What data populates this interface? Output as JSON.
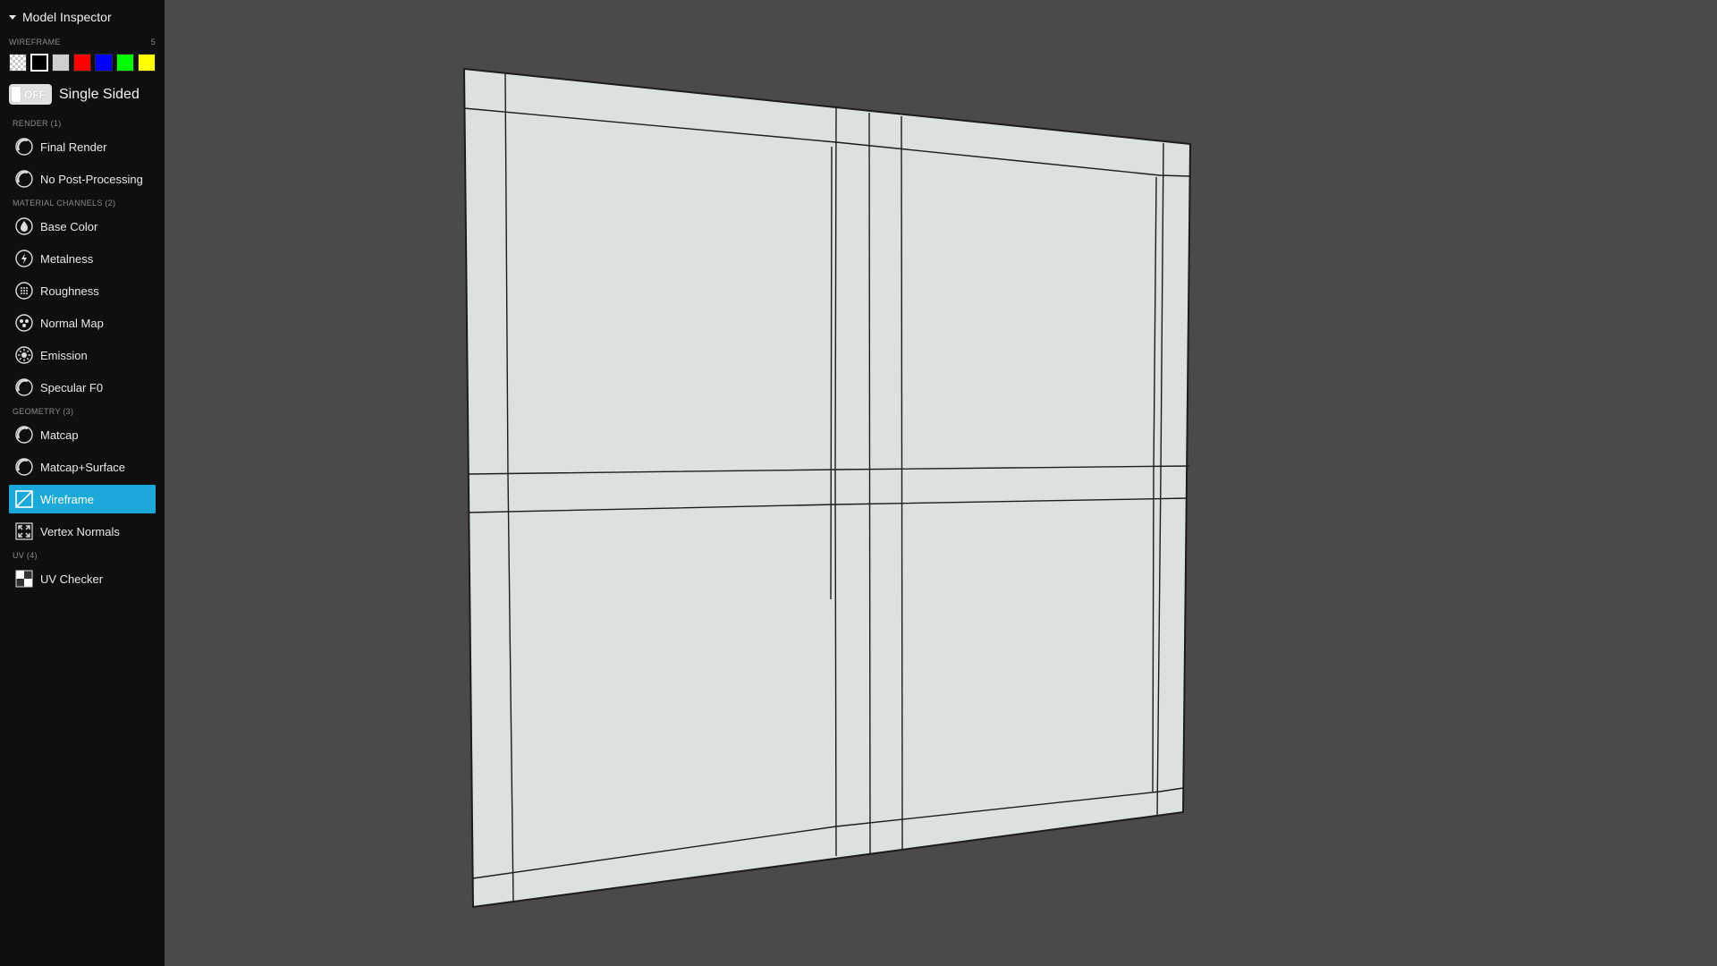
{
  "panel": {
    "title": "Model Inspector",
    "wireframe_label": "WIREFRAME",
    "wireframe_count": "5",
    "swatches": [
      {
        "name": "checker",
        "color": "#ffffff"
      },
      {
        "name": "black",
        "color": "#000000"
      },
      {
        "name": "light-gray",
        "color": "#cfcfcf"
      },
      {
        "name": "red",
        "color": "#ff0000"
      },
      {
        "name": "blue",
        "color": "#0000ff"
      },
      {
        "name": "green",
        "color": "#00ff00"
      },
      {
        "name": "yellow",
        "color": "#ffff00"
      }
    ],
    "toggle": {
      "state": "OFF",
      "label": "Single Sided"
    },
    "sections": [
      {
        "title": "RENDER (1)",
        "items": [
          {
            "label": "Final Render",
            "icon": "sphere-icon"
          },
          {
            "label": "No Post-Processing",
            "icon": "sphere-icon"
          }
        ]
      },
      {
        "title": "MATERIAL CHANNELS (2)",
        "items": [
          {
            "label": "Base Color",
            "icon": "droplet-icon"
          },
          {
            "label": "Metalness",
            "icon": "lightning-icon"
          },
          {
            "label": "Roughness",
            "icon": "dotted-sphere-icon"
          },
          {
            "label": "Normal Map",
            "icon": "normal-sphere-icon"
          },
          {
            "label": "Emission",
            "icon": "sun-icon"
          },
          {
            "label": "Specular F0",
            "icon": "sphere-icon"
          }
        ]
      },
      {
        "title": "GEOMETRY (3)",
        "items": [
          {
            "label": "Matcap",
            "icon": "sphere-icon"
          },
          {
            "label": "Matcap+Surface",
            "icon": "sphere-icon"
          },
          {
            "label": "Wireframe",
            "icon": "wireframe-icon",
            "active": true
          },
          {
            "label": "Vertex Normals",
            "icon": "arrows-icon"
          }
        ]
      },
      {
        "title": "UV (4)",
        "items": [
          {
            "label": "UV Checker",
            "icon": "checker-icon"
          }
        ]
      }
    ]
  },
  "colors": {
    "sidebar_bg": "#0f0f0f",
    "viewport_bg": "#4a4a4a",
    "accent": "#1aa9d9",
    "mesh_fill": "#dbe1e1",
    "wire": "#1c1c1c"
  }
}
